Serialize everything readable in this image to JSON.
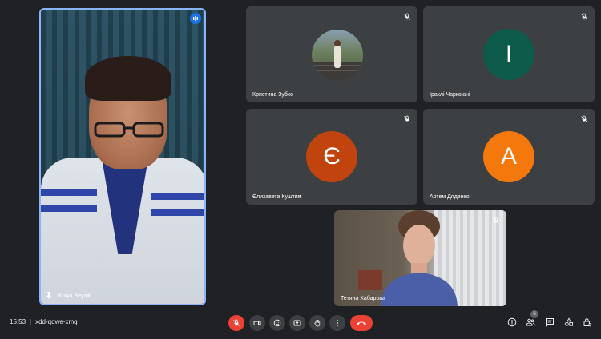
{
  "speaker": {
    "name": "Kolya Beynik"
  },
  "participants": [
    {
      "name": "Кристина Зубко",
      "type": "photo"
    },
    {
      "name": "Іраклі Чарквіані",
      "initial": "І",
      "color": "#0d5b4a"
    },
    {
      "name": "Єлизавета Куштим",
      "initial": "Є",
      "color": "#c1440e"
    },
    {
      "name": "Артем Дяденко",
      "initial": "А",
      "color": "#f4780b"
    },
    {
      "name": "Тетяна Хабарова",
      "type": "video"
    }
  ],
  "meeting": {
    "time": "15:53",
    "separator": "|",
    "code": "xdd-qqwe-xmq"
  },
  "people_count": "6",
  "icons": {
    "mic": "mic-off-icon",
    "camera": "camera-icon",
    "emoji": "emoji-icon",
    "present": "present-icon",
    "hand": "raise-hand-icon",
    "more": "more-vert-icon",
    "leave": "hangup-icon",
    "info": "info-icon",
    "people": "people-icon",
    "chat": "chat-icon",
    "activities": "activities-icon",
    "host": "host-controls-icon"
  },
  "colors": {
    "accent": "#8ab4f8",
    "danger": "#ea4335",
    "bg": "#202124",
    "tile": "#3c4043"
  }
}
